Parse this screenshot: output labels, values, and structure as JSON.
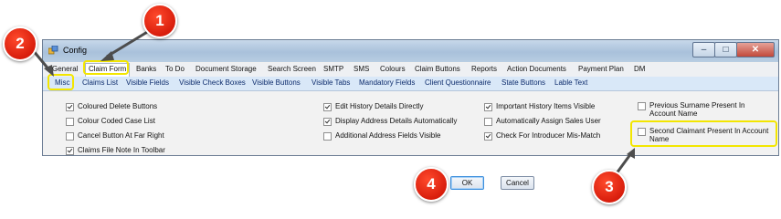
{
  "window": {
    "title": "Config"
  },
  "tabs_row1": [
    {
      "label": "General"
    },
    {
      "label": "Claim Form"
    },
    {
      "label": "Banks"
    },
    {
      "label": "To Do"
    },
    {
      "label": "Document Storage"
    },
    {
      "label": "Search Screen"
    },
    {
      "label": "SMTP"
    },
    {
      "label": "SMS"
    },
    {
      "label": "Colours"
    },
    {
      "label": "Claim Buttons"
    },
    {
      "label": "Reports"
    },
    {
      "label": "Action Documents"
    },
    {
      "label": "Payment Plan"
    },
    {
      "label": "DM"
    }
  ],
  "tabs_row2": [
    {
      "label": "Misc"
    },
    {
      "label": "Claims List"
    },
    {
      "label": "Visible Fields"
    },
    {
      "label": "Visible Check Boxes"
    },
    {
      "label": "Visible Buttons"
    },
    {
      "label": "Visible Tabs"
    },
    {
      "label": "Mandatory Fields"
    },
    {
      "label": "Client Questionnaire"
    },
    {
      "label": "State Buttons"
    },
    {
      "label": "Lable Text"
    }
  ],
  "options": {
    "col1": [
      {
        "label": "Coloured Delete Buttons",
        "checked": true
      },
      {
        "label": "Colour Coded Case List",
        "checked": false
      },
      {
        "label": "Cancel Button At Far Right",
        "checked": false
      },
      {
        "label": "Claims File Note In Toolbar",
        "checked": true
      }
    ],
    "col2": [
      {
        "label": "Edit History Details Directly",
        "checked": true
      },
      {
        "label": "Display Address Details Automatically",
        "checked": true
      },
      {
        "label": "Additional Address Fields Visible",
        "checked": false
      }
    ],
    "col3": [
      {
        "label": "Important History Items Visible",
        "checked": true
      },
      {
        "label": "Automatically Assign Sales User",
        "checked": false
      },
      {
        "label": "Check For Introducer Mis-Match",
        "checked": true
      }
    ],
    "col4": [
      {
        "label": "Previous Surname Present In Account Name",
        "checked": false
      },
      {
        "label": "Second Claimant Present In Account Name",
        "checked": false
      }
    ]
  },
  "buttons": {
    "ok": "OK",
    "cancel": "Cancel"
  },
  "callouts": {
    "one": "1",
    "two": "2",
    "three": "3",
    "four": "4"
  },
  "colors": {
    "callout": "#d81d0c",
    "highlight": "#f3e600"
  }
}
